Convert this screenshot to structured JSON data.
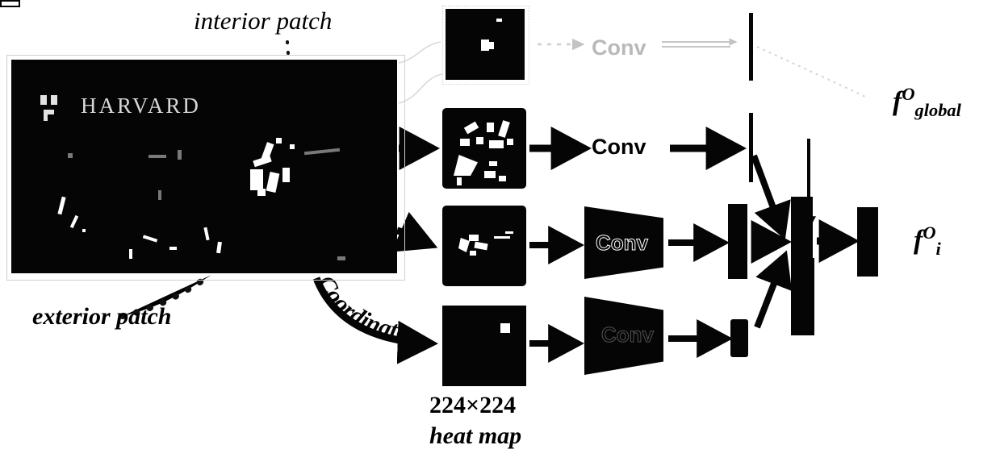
{
  "figure": {
    "type": "architecture-diagram",
    "domain": "pathology whole-slide image feature extraction network"
  },
  "source_image": {
    "name": "whole-slide-image",
    "wordmark": "HARVARD",
    "logo_name": "harvard-shield-logo"
  },
  "annotations": {
    "interior_patch": "interior patch",
    "exterior_patch": "exterior patch",
    "coordinate": "Coordinate"
  },
  "patches": [
    {
      "name": "interior-patch-thumbnail",
      "style": "dotted-outline"
    },
    {
      "name": "exterior-patch-thumbnail",
      "style": "solid"
    },
    {
      "name": "context-patch-thumbnail",
      "style": "solid"
    },
    {
      "name": "heat-map-thumbnail",
      "style": "solid"
    }
  ],
  "heatmap_caption": {
    "size": "224×224",
    "label": "heat map"
  },
  "conv_blocks": [
    {
      "name": "conv-top",
      "label": "Conv",
      "style": "faded-text"
    },
    {
      "name": "conv-mid",
      "label": "Conv",
      "style": "solid-text"
    },
    {
      "name": "conv-trapezoid-1",
      "label": "Conv",
      "style": "outlined-trapezoid"
    },
    {
      "name": "conv-trapezoid-2",
      "label": "Conv",
      "style": "faded-trapezoid"
    }
  ],
  "outputs": {
    "global_feature": {
      "base": "f",
      "sup": "O",
      "sub": "global"
    },
    "instance_feature": {
      "base": "f",
      "sup": "O",
      "sub": "i"
    }
  },
  "colors": {
    "ink": "#000000",
    "background": "#ffffff",
    "block_fill": "#050505",
    "faded": "#b9b9b9"
  }
}
